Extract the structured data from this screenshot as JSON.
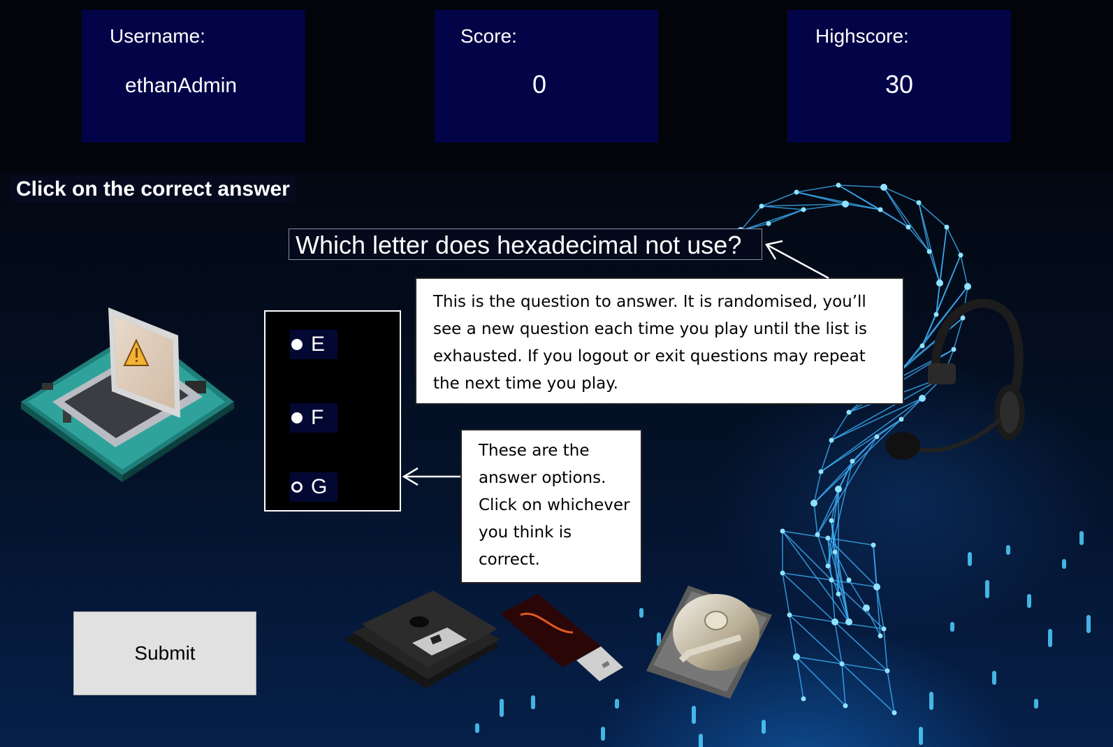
{
  "stats": {
    "username": {
      "label": "Username:",
      "value": "ethanAdmin"
    },
    "score": {
      "label": "Score:",
      "value": "0"
    },
    "highscore": {
      "label": "Highscore:",
      "value": "30"
    }
  },
  "quiz": {
    "heading": "Click on the correct answer",
    "question": "Which letter does hexadecimal not use?",
    "options": [
      {
        "label": "E",
        "selected": false
      },
      {
        "label": "F",
        "selected": false
      },
      {
        "label": "G",
        "selected": false
      }
    ],
    "submit_label": "Submit"
  },
  "callouts": {
    "question_help": "This is the question to answer. It is randomised, you’ll see a new question each time you play until the list is exhausted. If you logout or exit questions may repeat the next time you play.",
    "options_help": "These are the answer options. Click on whichever you think is correct."
  },
  "decor_icons": [
    "laptop-circuit-icon",
    "warning-icon",
    "headset-icon",
    "floppy-disks-icon",
    "usb-drive-icon",
    "hard-drive-icon",
    "network-head-icon"
  ],
  "colors": {
    "stat_box": "#020447",
    "option_bg": "#030833",
    "submit_bg": "#e1e1e1",
    "network_glow": "#35b8ff"
  }
}
